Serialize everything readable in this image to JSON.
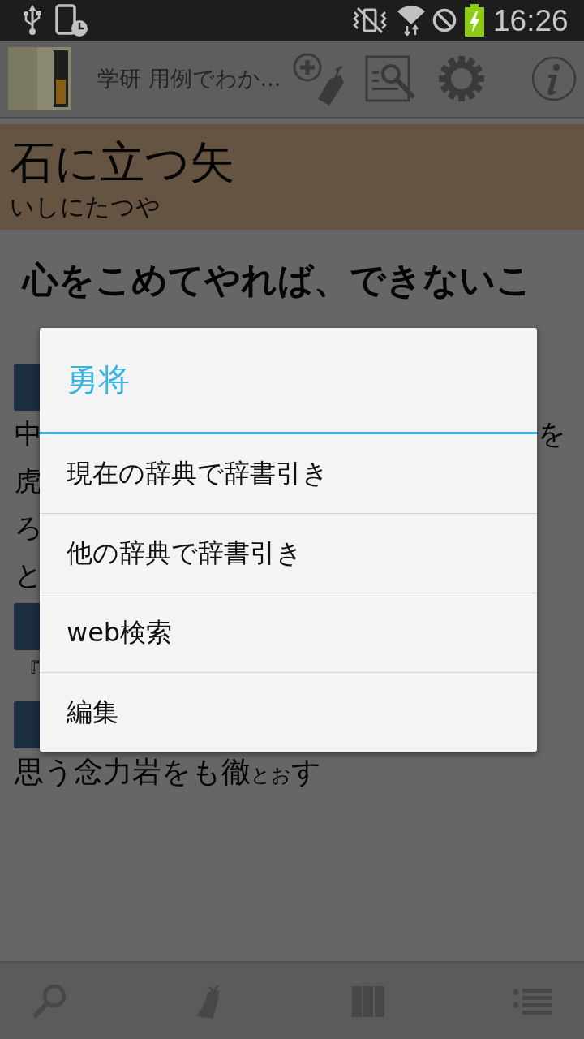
{
  "status_bar": {
    "time": "16:26"
  },
  "app_bar": {
    "title": "学研 用例でわか..."
  },
  "entry": {
    "headword": "石に立つ矢",
    "reading": "いしにたつや"
  },
  "definition": "心をこめてやれば、できないこ",
  "sections": [
    {
      "lines": [
        {
          "kind": "cut",
          "start": "中",
          "end": "を"
        },
        {
          "kind": "cut",
          "start": "虎"
        },
        {
          "kind": "cut",
          "start": "ろ"
        },
        {
          "kind": "cut",
          "start": "と"
        }
      ]
    },
    {
      "lines": [
        {
          "kind": "cut",
          "start": "『"
        }
      ]
    },
    {
      "lines": [
        {
          "kind": "full",
          "text": "思う念力岩をも徹$_{とお}$す"
        }
      ]
    }
  ],
  "dialog": {
    "title": "勇将",
    "items": [
      "現在の辞典で辞書引き",
      "他の辞典で辞書引き",
      "web検索",
      "編集"
    ]
  }
}
